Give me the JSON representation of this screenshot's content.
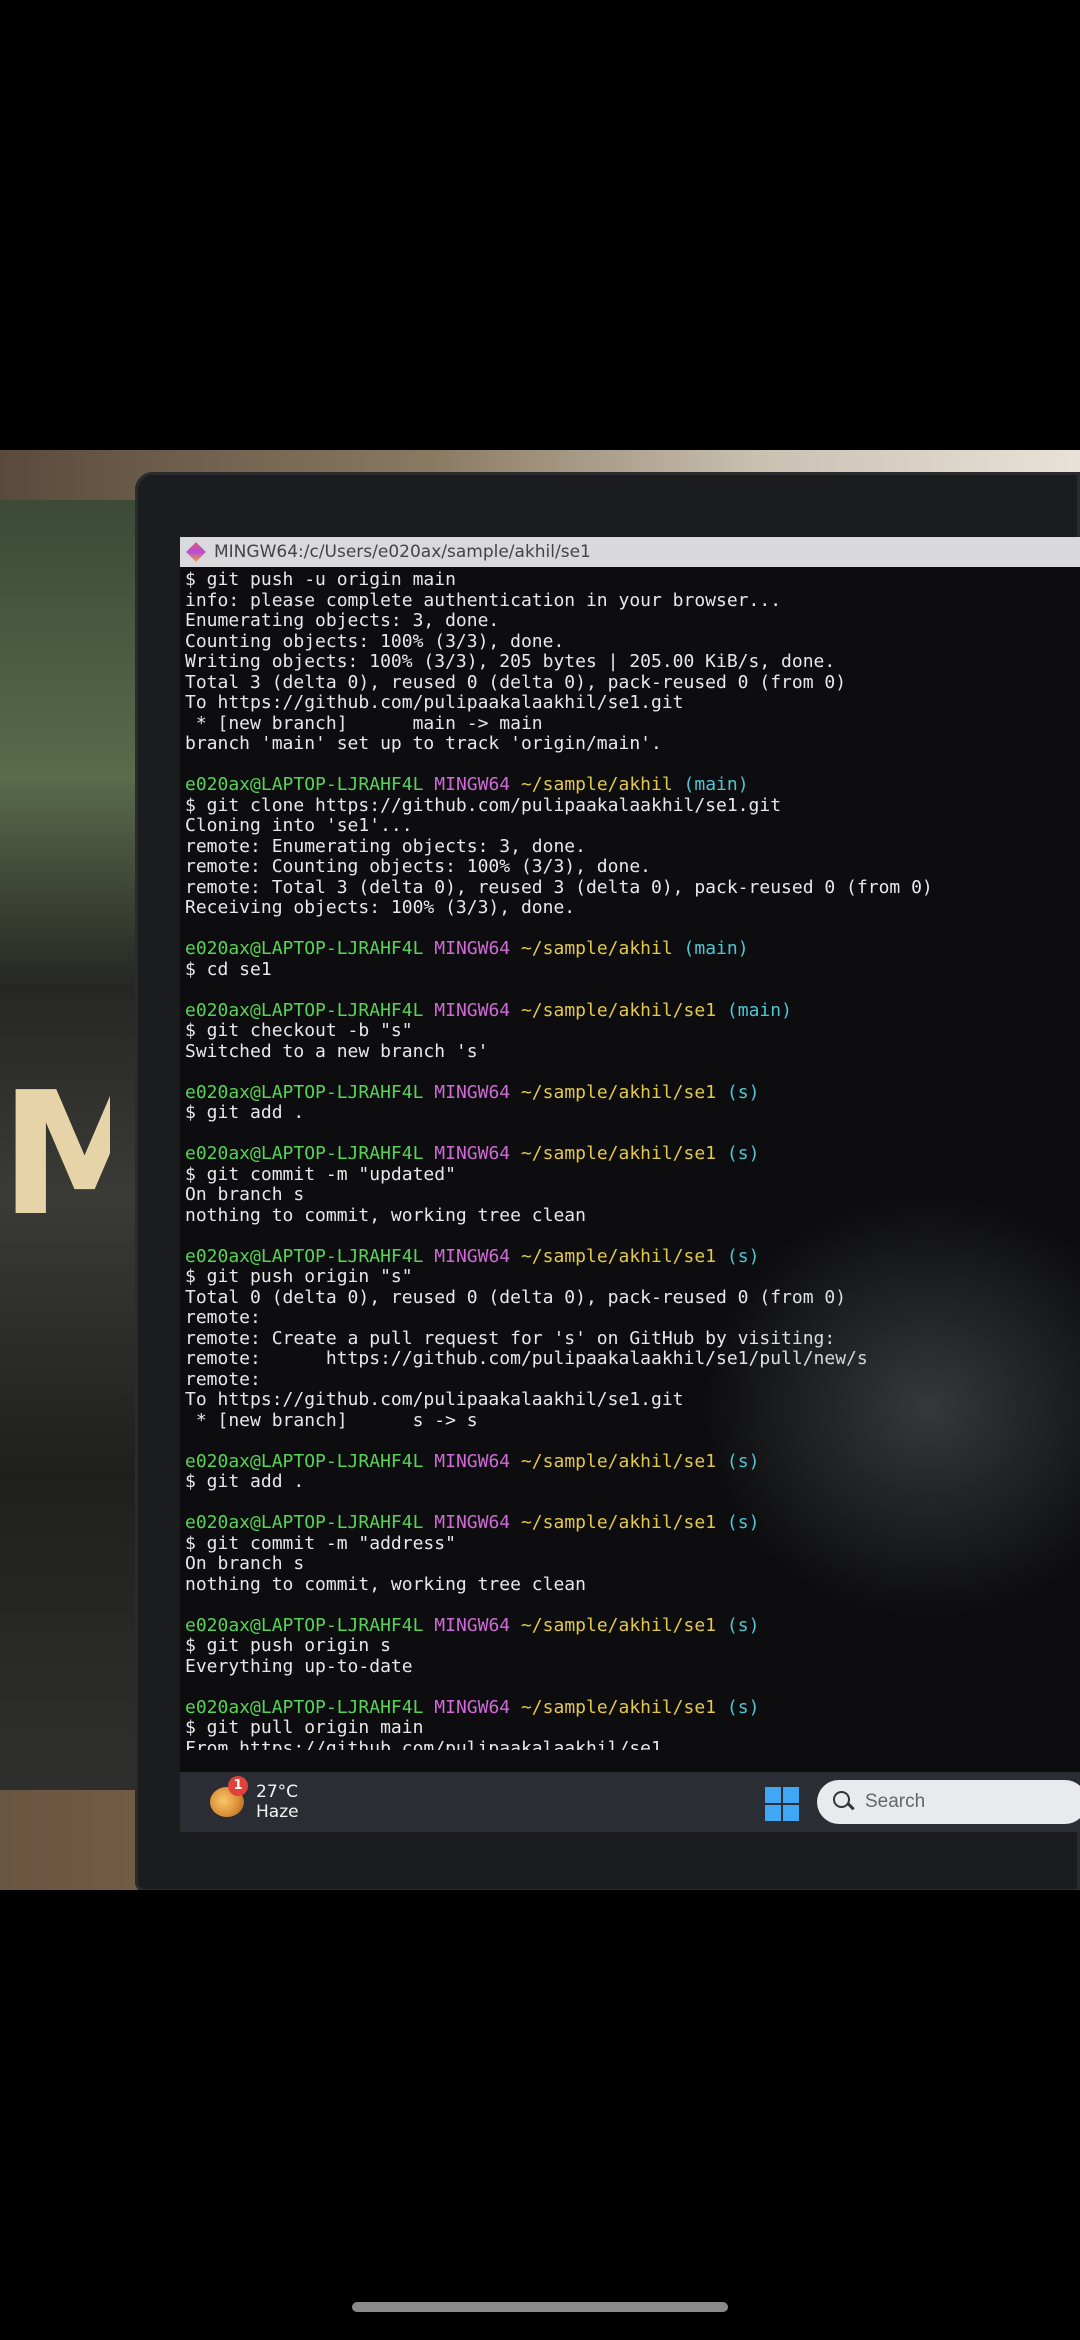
{
  "window": {
    "title": "MINGW64:/c/Users/e020ax/sample/akhil/se1"
  },
  "terminal": {
    "user_host": "e020ax@LAPTOP-LJRAHF4L",
    "shell": "MINGW64",
    "lines": [
      {
        "type": "text",
        "text": "$ git push -u origin main"
      },
      {
        "type": "text",
        "text": "info: please complete authentication in your browser..."
      },
      {
        "type": "text",
        "text": "Enumerating objects: 3, done."
      },
      {
        "type": "text",
        "text": "Counting objects: 100% (3/3), done."
      },
      {
        "type": "text",
        "text": "Writing objects: 100% (3/3), 205 bytes | 205.00 KiB/s, done."
      },
      {
        "type": "text",
        "text": "Total 3 (delta 0), reused 0 (delta 0), pack-reused 0 (from 0)"
      },
      {
        "type": "text",
        "text": "To https://github.com/pulipaakalaakhil/se1.git"
      },
      {
        "type": "text",
        "text": " * [new branch]      main -> main"
      },
      {
        "type": "text",
        "text": "branch 'main' set up to track 'origin/main'."
      },
      {
        "type": "blank"
      },
      {
        "type": "prompt",
        "path": "~/sample/akhil",
        "branch": "(main)"
      },
      {
        "type": "text",
        "text": "$ git clone https://github.com/pulipaakalaakhil/se1.git"
      },
      {
        "type": "text",
        "text": "Cloning into 'se1'..."
      },
      {
        "type": "text",
        "text": "remote: Enumerating objects: 3, done."
      },
      {
        "type": "text",
        "text": "remote: Counting objects: 100% (3/3), done."
      },
      {
        "type": "text",
        "text": "remote: Total 3 (delta 0), reused 3 (delta 0), pack-reused 0 (from 0)"
      },
      {
        "type": "text",
        "text": "Receiving objects: 100% (3/3), done."
      },
      {
        "type": "blank"
      },
      {
        "type": "prompt",
        "path": "~/sample/akhil",
        "branch": "(main)"
      },
      {
        "type": "text",
        "text": "$ cd se1"
      },
      {
        "type": "blank"
      },
      {
        "type": "prompt",
        "path": "~/sample/akhil/se1",
        "branch": "(main)"
      },
      {
        "type": "text",
        "text": "$ git checkout -b \"s\""
      },
      {
        "type": "text",
        "text": "Switched to a new branch 's'"
      },
      {
        "type": "blank"
      },
      {
        "type": "prompt",
        "path": "~/sample/akhil/se1",
        "branch": "(s)"
      },
      {
        "type": "text",
        "text": "$ git add ."
      },
      {
        "type": "blank"
      },
      {
        "type": "prompt",
        "path": "~/sample/akhil/se1",
        "branch": "(s)"
      },
      {
        "type": "text",
        "text": "$ git commit -m \"updated\""
      },
      {
        "type": "text",
        "text": "On branch s"
      },
      {
        "type": "text",
        "text": "nothing to commit, working tree clean"
      },
      {
        "type": "blank"
      },
      {
        "type": "prompt",
        "path": "~/sample/akhil/se1",
        "branch": "(s)"
      },
      {
        "type": "text",
        "text": "$ git push origin \"s\""
      },
      {
        "type": "text",
        "text": "Total 0 (delta 0), reused 0 (delta 0), pack-reused 0 (from 0)"
      },
      {
        "type": "text",
        "text": "remote:"
      },
      {
        "type": "text",
        "text": "remote: Create a pull request for 's' on GitHub by visiting:"
      },
      {
        "type": "text",
        "text": "remote:      https://github.com/pulipaakalaakhil/se1/pull/new/s"
      },
      {
        "type": "text",
        "text": "remote:"
      },
      {
        "type": "text",
        "text": "To https://github.com/pulipaakalaakhil/se1.git"
      },
      {
        "type": "text",
        "text": " * [new branch]      s -> s"
      },
      {
        "type": "blank"
      },
      {
        "type": "prompt",
        "path": "~/sample/akhil/se1",
        "branch": "(s)"
      },
      {
        "type": "text",
        "text": "$ git add ."
      },
      {
        "type": "blank"
      },
      {
        "type": "prompt",
        "path": "~/sample/akhil/se1",
        "branch": "(s)"
      },
      {
        "type": "text",
        "text": "$ git commit -m \"address\""
      },
      {
        "type": "text",
        "text": "On branch s"
      },
      {
        "type": "text",
        "text": "nothing to commit, working tree clean"
      },
      {
        "type": "blank"
      },
      {
        "type": "prompt",
        "path": "~/sample/akhil/se1",
        "branch": "(s)"
      },
      {
        "type": "text",
        "text": "$ git push origin s"
      },
      {
        "type": "text",
        "text": "Everything up-to-date"
      },
      {
        "type": "blank"
      },
      {
        "type": "prompt",
        "path": "~/sample/akhil/se1",
        "branch": "(s)"
      },
      {
        "type": "text",
        "text": "$ git pull origin main"
      },
      {
        "type": "text",
        "text": "From https://github.com/pulipaakalaakhil/se1"
      }
    ]
  },
  "taskbar": {
    "weather_temp": "27°C",
    "weather_desc": "Haze",
    "weather_badge": "1",
    "search_placeholder": "Search"
  },
  "scene": {
    "bag_letter": "M"
  },
  "colors": {
    "user": "#57d357",
    "shell": "#d16ad8",
    "path": "#e3c84a",
    "branch": "#4fc6d4",
    "windows_blue": "#3fa7f3"
  }
}
